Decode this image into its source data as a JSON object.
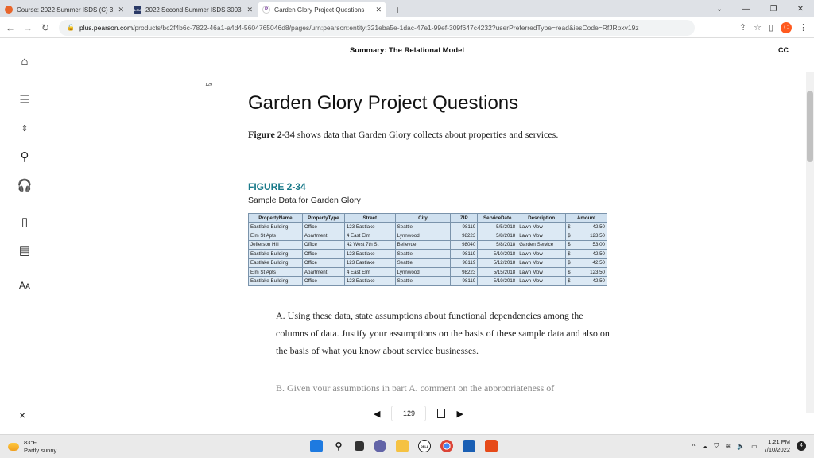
{
  "browser": {
    "tabs": [
      {
        "label": "Course: 2022 Summer ISDS (C) 3",
        "favicon_color": "#e8652b",
        "favicon_text": "",
        "active": false
      },
      {
        "label": "2022 Second Summer ISDS 3003",
        "favicon_color": "#2b3a67",
        "favicon_text": "LSU",
        "active": false
      },
      {
        "label": "Garden Glory Project Questions",
        "favicon_color": "#ffffff",
        "favicon_text": "P",
        "active": true
      }
    ],
    "new_tab": "+",
    "url_host": "plus.pearson.com",
    "url_path": "/products/bc2f4b6c-7822-46a1-a4d4-5604765046d8/pages/urn:pearson:entity:321eba5e-1dac-47e1-99ef-309f647c4232?userPreferredType=read&iesCode=RfJRpxv19z",
    "profile_letter": "C"
  },
  "reader": {
    "header_title": "Summary: The Relational Model",
    "cc_label": "CC",
    "page_number_top": "129",
    "title": "Garden Glory Project Questions",
    "intro_bold": "Figure 2-34",
    "intro_rest": " shows data that Garden Glory collects about properties and services.",
    "figure_label": "FIGURE 2-34",
    "figure_caption": "Sample Data for Garden Glory",
    "table": {
      "headers": [
        "PropertyName",
        "PropertyType",
        "Street",
        "City",
        "ZIP",
        "ServiceDate",
        "Description",
        "Amount"
      ],
      "rows": [
        [
          "Eastlake Building",
          "Office",
          "123 Eastlake",
          "Seattle",
          "98119",
          "5/5/2018",
          "Lawn Mow",
          "$",
          "42.50"
        ],
        [
          "Elm St Apts",
          "Apartment",
          "4 East Elm",
          "Lynnwood",
          "98223",
          "5/8/2018",
          "Lawn Mow",
          "$",
          "123.50"
        ],
        [
          "Jefferson Hill",
          "Office",
          "42 West 7th St",
          "Bellevue",
          "98040",
          "5/8/2018",
          "Garden Service",
          "$",
          "53.00"
        ],
        [
          "Eastlake Building",
          "Office",
          "123 Eastlake",
          "Seattle",
          "98119",
          "5/10/2018",
          "Lawn Mow",
          "$",
          "42.50"
        ],
        [
          "Eastlake Building",
          "Office",
          "123 Eastlake",
          "Seattle",
          "98119",
          "5/12/2018",
          "Lawn Mow",
          "$",
          "42.50"
        ],
        [
          "Elm St Apts",
          "Apartment",
          "4 East Elm",
          "Lynnwood",
          "98223",
          "5/15/2018",
          "Lawn Mow",
          "$",
          "123.50"
        ],
        [
          "Eastlake Building",
          "Office",
          "123 Eastlake",
          "Seattle",
          "98119",
          "5/19/2018",
          "Lawn Mow",
          "$",
          "42.50"
        ]
      ]
    },
    "question_a": "A. Using these data, state assumptions about functional dependencies among the columns of data. Justify your assumptions on the basis of these sample data and also on the basis of what you know about service businesses.",
    "question_b_partial": "B. Given your assumptions in part A, comment on the appropriateness of",
    "pager": {
      "page": "129"
    },
    "close_icon": "×"
  },
  "taskbar": {
    "weather_temp": "83°F",
    "weather_desc": "Partly sunny",
    "time": "1:21 PM",
    "date": "7/10/2022",
    "notifications": "4"
  }
}
